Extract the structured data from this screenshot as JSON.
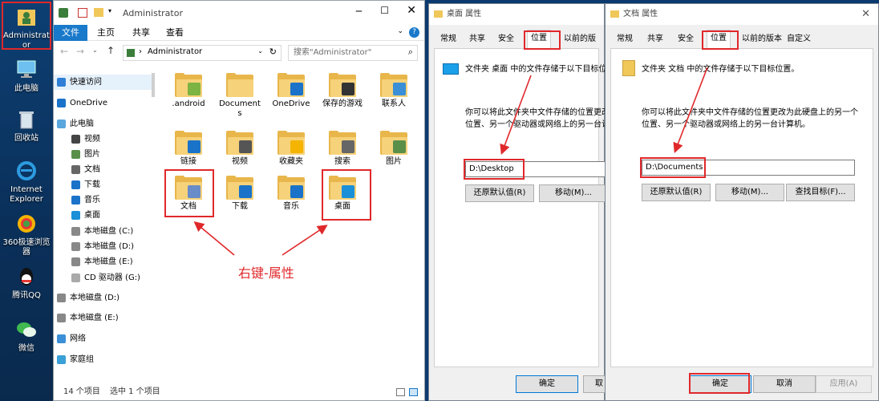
{
  "desktop": {
    "icons": [
      {
        "label": "Administrat\nor",
        "icon": "user-folder-icon"
      },
      {
        "label": "此电脑",
        "icon": "this-pc-icon"
      },
      {
        "label": "回收站",
        "icon": "recycle-bin-icon"
      },
      {
        "label": "Internet\nExplorer",
        "icon": "internet-explorer-icon"
      },
      {
        "label": "360极速浏览\n器",
        "icon": "browser-360-icon"
      },
      {
        "label": "腾讯QQ",
        "icon": "qq-icon"
      },
      {
        "label": "微信",
        "icon": "wechat-icon"
      }
    ]
  },
  "explorer": {
    "title": "Administrator",
    "ribbon_tabs": [
      "文件",
      "主页",
      "共享",
      "查看"
    ],
    "address": "Administrator",
    "search_placeholder": "搜索\"Administrator\"",
    "nav_items": [
      {
        "label": "快速访问",
        "icon": "star-icon"
      },
      {
        "label": "OneDrive",
        "icon": "cloud-icon"
      },
      {
        "label": "此电脑",
        "icon": "computer-icon"
      },
      {
        "label": "视频",
        "icon": "video-icon"
      },
      {
        "label": "图片",
        "icon": "picture-icon"
      },
      {
        "label": "文档",
        "icon": "document-icon"
      },
      {
        "label": "下载",
        "icon": "download-icon"
      },
      {
        "label": "音乐",
        "icon": "music-icon"
      },
      {
        "label": "桌面",
        "icon": "desktop-icon"
      },
      {
        "label": "本地磁盘 (C:)",
        "icon": "drive-icon"
      },
      {
        "label": "本地磁盘 (D:)",
        "icon": "drive-icon"
      },
      {
        "label": "本地磁盘 (E:)",
        "icon": "drive-icon"
      },
      {
        "label": "CD 驱动器 (G:)",
        "icon": "cd-icon"
      },
      {
        "label": "本地磁盘 (D:)",
        "icon": "drive-icon"
      },
      {
        "label": "本地磁盘 (E:)",
        "icon": "drive-icon"
      },
      {
        "label": "网络",
        "icon": "network-icon"
      },
      {
        "label": "家庭组",
        "icon": "homegroup-icon"
      }
    ],
    "folders": [
      {
        "label": ".android",
        "badge": "file-icon"
      },
      {
        "label": "Document\ns",
        "badge": ""
      },
      {
        "label": "OneDrive",
        "badge": "cloud-icon"
      },
      {
        "label": "保存的游戏",
        "badge": "chess-icon"
      },
      {
        "label": "联系人",
        "badge": "contact-card-icon"
      },
      {
        "label": "链接",
        "badge": "link-arrow-icon"
      },
      {
        "label": "视频",
        "badge": "film-icon"
      },
      {
        "label": "收藏夹",
        "badge": "star-icon"
      },
      {
        "label": "搜索",
        "badge": "magnifier-icon"
      },
      {
        "label": "图片",
        "badge": "landscape-icon"
      },
      {
        "label": "文档",
        "badge": "document-icon"
      },
      {
        "label": "下载",
        "badge": "download-arrow-icon"
      },
      {
        "label": "音乐",
        "badge": "music-note-icon"
      },
      {
        "label": "桌面",
        "badge": "desktop-screen-icon"
      }
    ],
    "annotation": "右键-属性",
    "status_items": "14 个项目",
    "status_selected": "选中 1 个项目"
  },
  "dialog_desktop": {
    "title": "桌面 属性",
    "tabs": [
      "常规",
      "共享",
      "安全",
      "位置",
      "以前的版本"
    ],
    "active_tab": "位置",
    "desc1": "文件夹 桌面 中的文件存储于以下目标位",
    "desc2": "你可以将此文件夹中文件存储的位置更改",
    "desc3": "位置、另一个驱动器或网络上的另一台计",
    "path": "D:\\Desktop",
    "btn_restore": "还原默认值(R)",
    "btn_move": "移动(M)...",
    "btn_ok": "确定",
    "btn_cancel": "取"
  },
  "dialog_documents": {
    "title": "文档 属性",
    "tabs": [
      "常规",
      "共享",
      "安全",
      "位置",
      "以前的版本",
      "自定义"
    ],
    "active_tab": "位置",
    "desc1": "文件夹 文档 中的文件存储于以下目标位置。",
    "desc2": "你可以将此文件夹中文件存储的位置更改为此硬盘上的另一个",
    "desc3": "位置、另一个驱动器或网络上的另一台计算机。",
    "path": "D:\\Documents",
    "btn_restore": "还原默认值(R)",
    "btn_move": "移动(M)...",
    "btn_find": "查找目标(F)...",
    "btn_ok": "确定",
    "btn_cancel": "取消",
    "btn_apply": "应用(A)"
  },
  "colors": {
    "annotation_red": "#e0282b",
    "ribbon_blue": "#1979ca",
    "folder_yellow": "#f6d27a"
  }
}
